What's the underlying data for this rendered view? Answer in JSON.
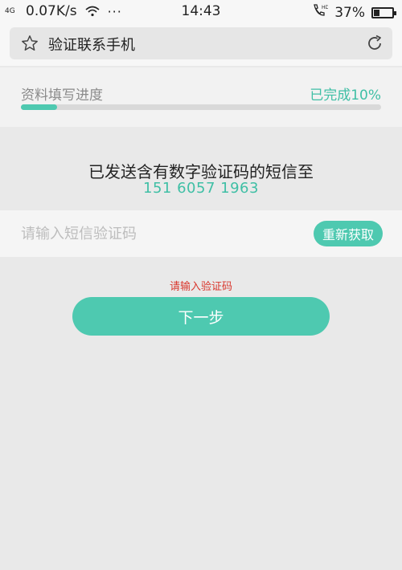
{
  "status_bar": {
    "signal": "4G",
    "net_speed": "0.07K/s",
    "more": "···",
    "time": "14:43",
    "battery": "37%",
    "battery_level": 0.37,
    "wifi_icon": "wifi-icon",
    "call_icon": "hd-call-icon"
  },
  "header": {
    "title": "验证联系手机",
    "star_icon": "star-icon",
    "reload_icon": "reload-icon"
  },
  "progress": {
    "label": "资料填写进度",
    "status": "已完成10%",
    "value": 0.1
  },
  "message": {
    "sent_text": "已发送含有数字验证码的短信至",
    "phone": "151 6057 1963"
  },
  "code": {
    "placeholder": "请输入短信验证码",
    "value": "",
    "resend_label": "重新获取"
  },
  "error": "请输入验证码",
  "next_label": "下一步",
  "colors": {
    "accent": "#4ec9b0",
    "error": "#d9372d"
  }
}
